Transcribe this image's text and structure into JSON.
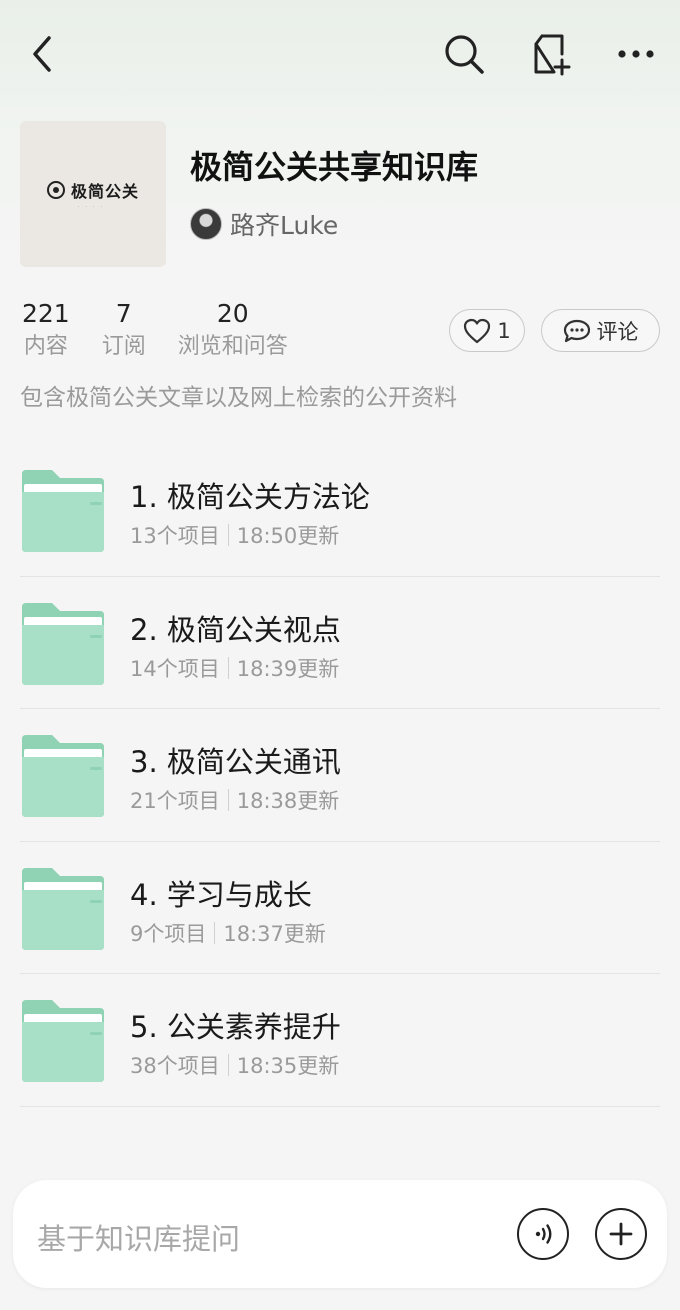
{
  "colors": {
    "folder": "#a7e0c7",
    "folder_tab": "#8fd2b4",
    "page_bg": "#f5f5f5"
  },
  "topbar": {
    "back_icon": "chevron-left-icon",
    "search_icon": "search-icon",
    "new_doc_icon": "new-document-icon",
    "more_icon": "more-dots-icon"
  },
  "knowledge_base": {
    "cover_text": "极简公关",
    "title": "极简公关共享知识库",
    "owner": "路齐Luke",
    "description": "包含极简公关文章以及网上检索的公开资料"
  },
  "stats": [
    {
      "value": "221",
      "label": "内容"
    },
    {
      "value": "7",
      "label": "订阅"
    },
    {
      "value": "20",
      "label": "浏览和问答"
    }
  ],
  "actions": {
    "like_count": "1",
    "comment_label": "评论"
  },
  "folders": [
    {
      "name": "1. 极简公关方法论",
      "count": "13个项目",
      "updated": "18:50更新"
    },
    {
      "name": "2. 极简公关视点",
      "count": "14个项目",
      "updated": "18:39更新"
    },
    {
      "name": "3. 极简公关通讯",
      "count": "21个项目",
      "updated": "18:38更新"
    },
    {
      "name": "4. 学习与成长",
      "count": "9个项目",
      "updated": "18:37更新"
    },
    {
      "name": "5. 公关素养提升",
      "count": "38个项目",
      "updated": "18:35更新"
    }
  ],
  "ask": {
    "placeholder": "基于知识库提问",
    "voice_icon": "voice-icon",
    "add_icon": "plus-icon"
  }
}
